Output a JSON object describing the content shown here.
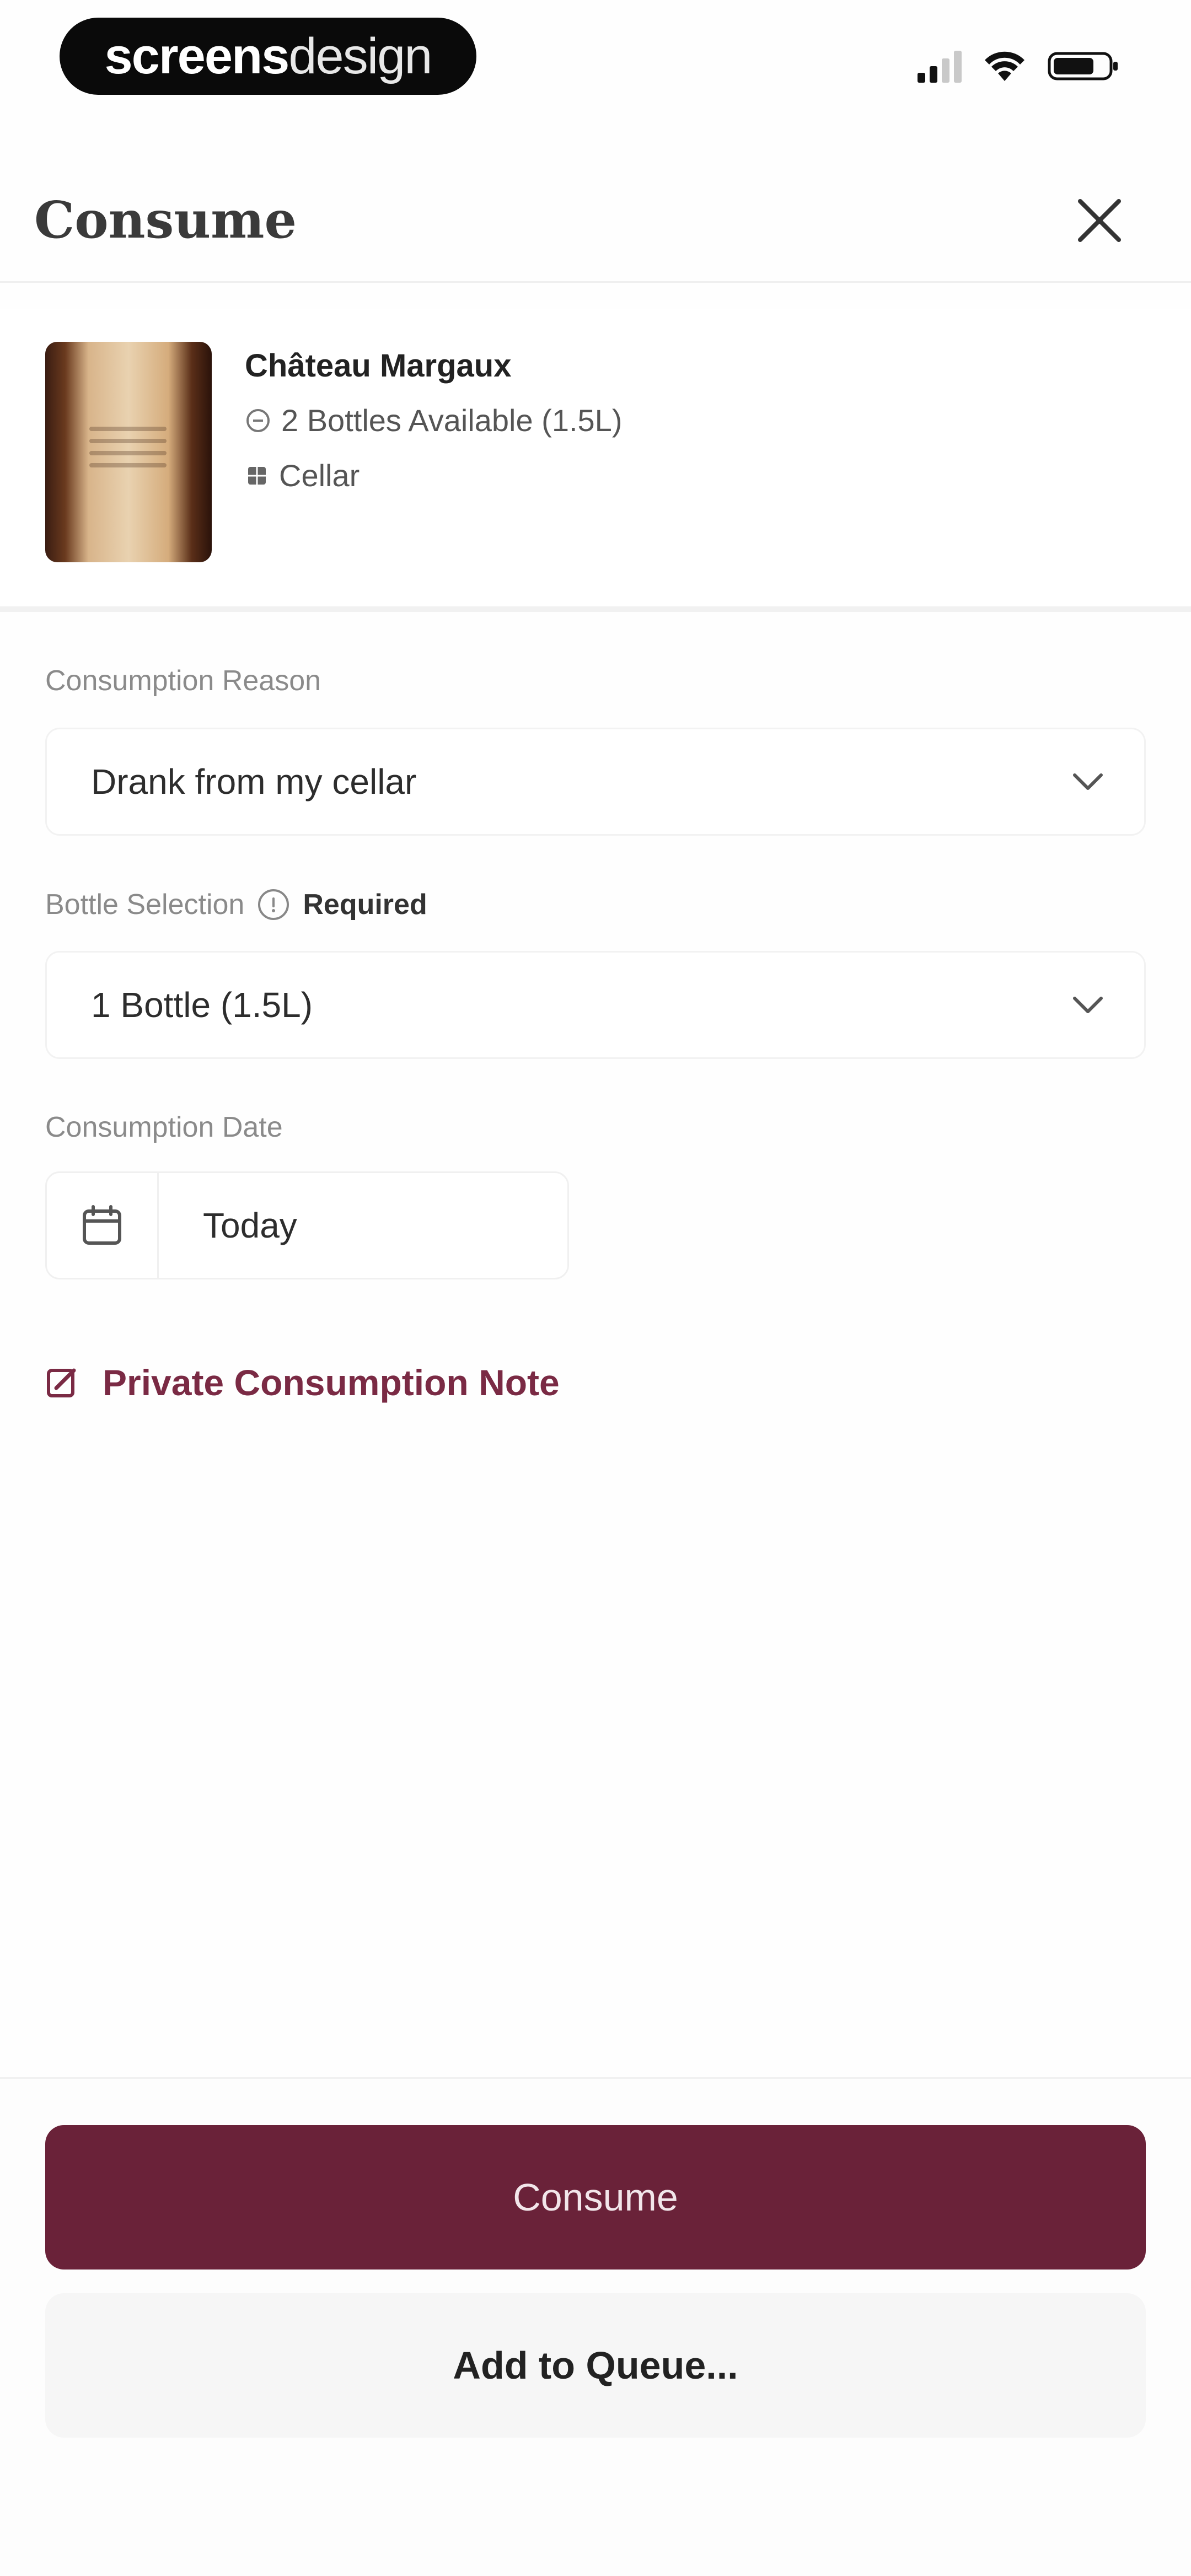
{
  "status_bar": {
    "brand_bold": "screens",
    "brand_light": "design",
    "signal_icon": "signal-icon",
    "wifi_icon": "wifi-icon",
    "battery_icon": "battery-icon"
  },
  "header": {
    "title": "Consume",
    "close_icon": "close-icon"
  },
  "wine": {
    "name": "Château Margaux",
    "availability": "2 Bottles Available (1.5L)",
    "location": "Cellar"
  },
  "form": {
    "reason": {
      "label": "Consumption Reason",
      "value": "Drank from my cellar"
    },
    "bottle": {
      "label": "Bottle Selection",
      "required_text": "Required",
      "value": "1 Bottle (1.5L)"
    },
    "date": {
      "label": "Consumption Date",
      "value": "Today"
    },
    "note_link": "Private Consumption Note"
  },
  "actions": {
    "primary": "Consume",
    "secondary": "Add to Queue..."
  },
  "colors": {
    "accent": "#6a2239",
    "link": "#7a2a44"
  }
}
